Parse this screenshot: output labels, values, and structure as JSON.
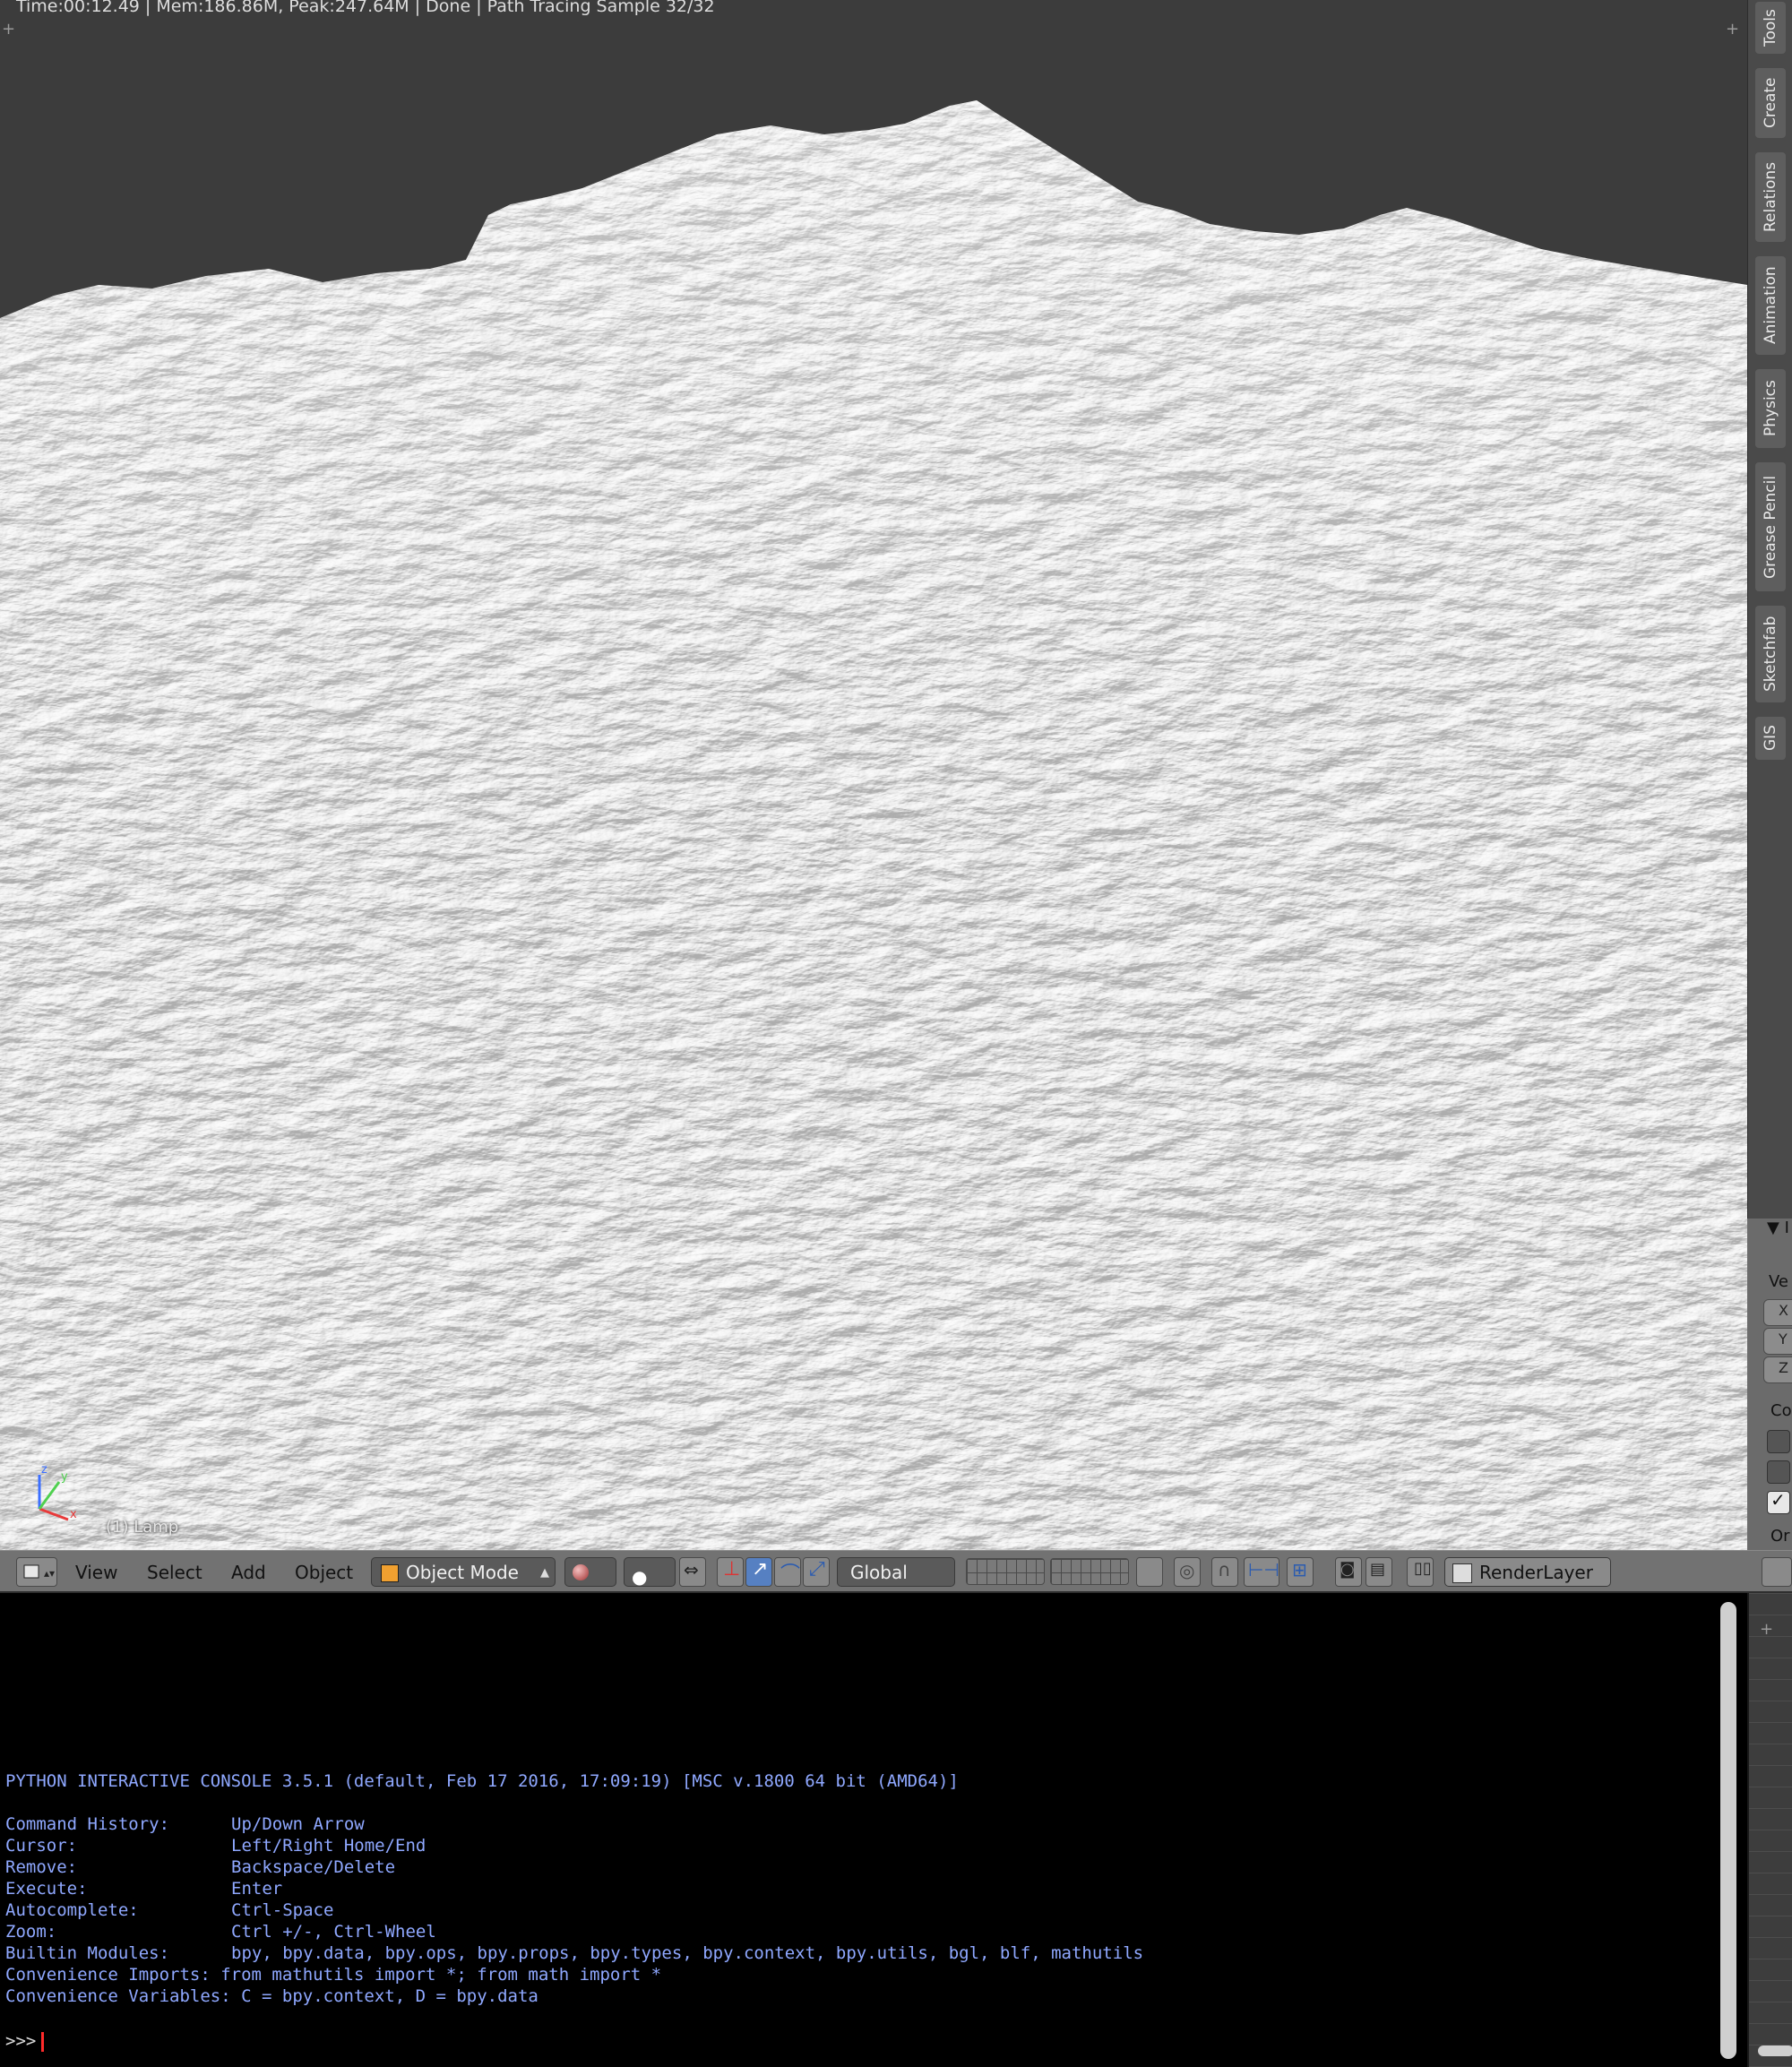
{
  "status_bar": {
    "text": "Time:00:12.49 | Mem:186.86M, Peak:247.64M | Done | Path Tracing Sample 32/32"
  },
  "viewport": {
    "object_label": "(1) Lamp",
    "axes": {
      "x": "x",
      "y": "y",
      "z": "z"
    }
  },
  "right_tabs": [
    "Tools",
    "Create",
    "Relations",
    "Animation",
    "Physics",
    "Grease Pencil",
    "Sketchfab",
    "GIS"
  ],
  "right_panel": {
    "section_marker": "▼ I",
    "label_ve": "Ve",
    "fields": [
      "X",
      "Y",
      "Z"
    ],
    "label_co": "Co",
    "label_or": "Or"
  },
  "header": {
    "menu": [
      "View",
      "Select",
      "Add",
      "Object"
    ],
    "mode": "Object Mode",
    "orientation": "Global",
    "render_layer": "RenderLayer"
  },
  "console": {
    "banner": "PYTHON INTERACTIVE CONSOLE 3.5.1 (default, Feb 17 2016, 17:09:19) [MSC v.1800 64 bit (AMD64)]",
    "help": [
      {
        "key": "Command History:",
        "value": "Up/Down Arrow"
      },
      {
        "key": "Cursor:",
        "value": "Left/Right Home/End"
      },
      {
        "key": "Remove:",
        "value": "Backspace/Delete"
      },
      {
        "key": "Execute:",
        "value": "Enter"
      },
      {
        "key": "Autocomplete:",
        "value": "Ctrl-Space"
      },
      {
        "key": "Zoom:",
        "value": "Ctrl +/-, Ctrl-Wheel"
      },
      {
        "key": "Builtin Modules:",
        "value": "bpy, bpy.data, bpy.ops, bpy.props, bpy.types, bpy.context, bpy.utils, bgl, blf, mathutils"
      },
      {
        "key": "Convenience Imports:",
        "value": "from mathutils import *; from math import *"
      },
      {
        "key": "Convenience Variables:",
        "value": "C = bpy.context, D = bpy.data"
      }
    ],
    "prompt": ">>>"
  },
  "colors": {
    "console_text": "#8fa8ff",
    "cursor": "#ff2a2a",
    "active_tool": "#5680c2"
  }
}
